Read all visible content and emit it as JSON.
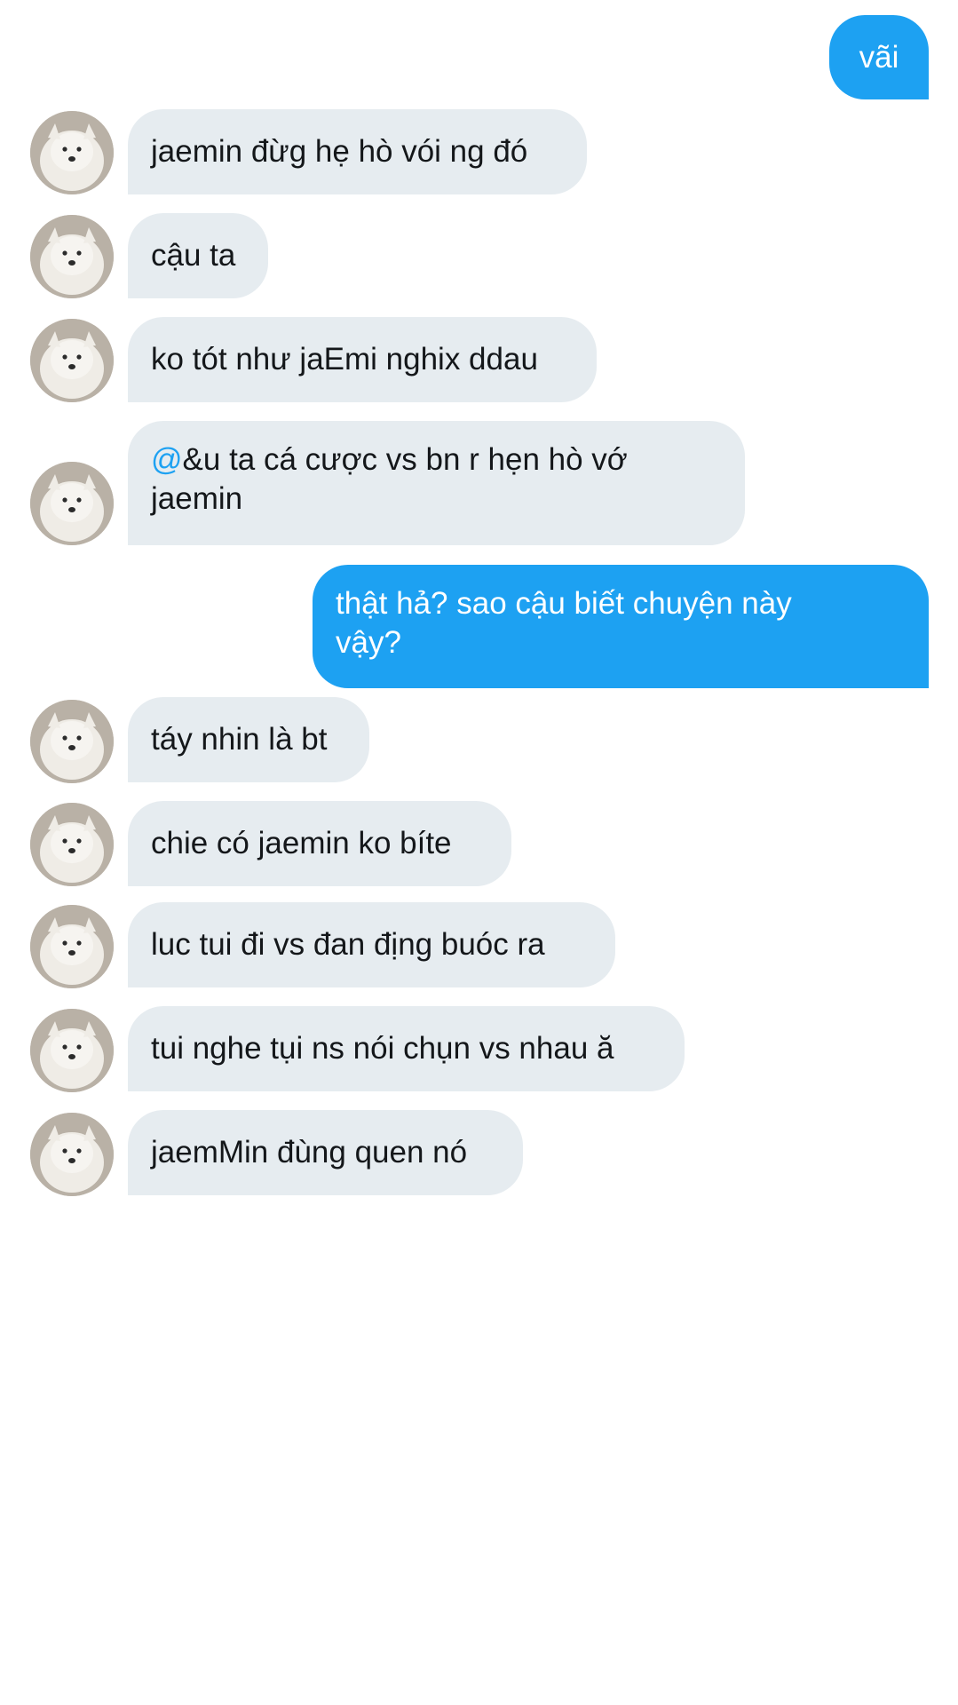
{
  "messages": [
    {
      "direction": "outgoing",
      "text": "vãi"
    },
    {
      "direction": "incoming",
      "text": "jaemin đừg hẹ hò vói ng đó"
    },
    {
      "direction": "incoming",
      "text": "cậu ta"
    },
    {
      "direction": "incoming",
      "text": "ko tót như jaEmi nghix ddau"
    },
    {
      "direction": "incoming",
      "mention": "@",
      "text": "&u ta cá cược vs bn r hẹn hò vớ jaemin"
    },
    {
      "direction": "outgoing",
      "text": "thật hả? sao cậu biết chuyện này vậy?"
    },
    {
      "direction": "incoming",
      "text": "táy nhin là bt"
    },
    {
      "direction": "incoming",
      "text": "chie có jaemin ko bíte"
    },
    {
      "direction": "incoming",
      "text": "luc tui đi vs đan địng buóc ra"
    },
    {
      "direction": "incoming",
      "text": "tui nghe tụi ns nói chụn vs nhau ă"
    },
    {
      "direction": "incoming",
      "text": "jaemMin đùng quen nó"
    }
  ],
  "colors": {
    "outgoing_bubble": "#1da1f2",
    "incoming_bubble": "#e6ecf0",
    "mention": "#1da1f2",
    "background": "#ffffff"
  },
  "avatar": {
    "icon": "samoyed-dog-avatar"
  }
}
